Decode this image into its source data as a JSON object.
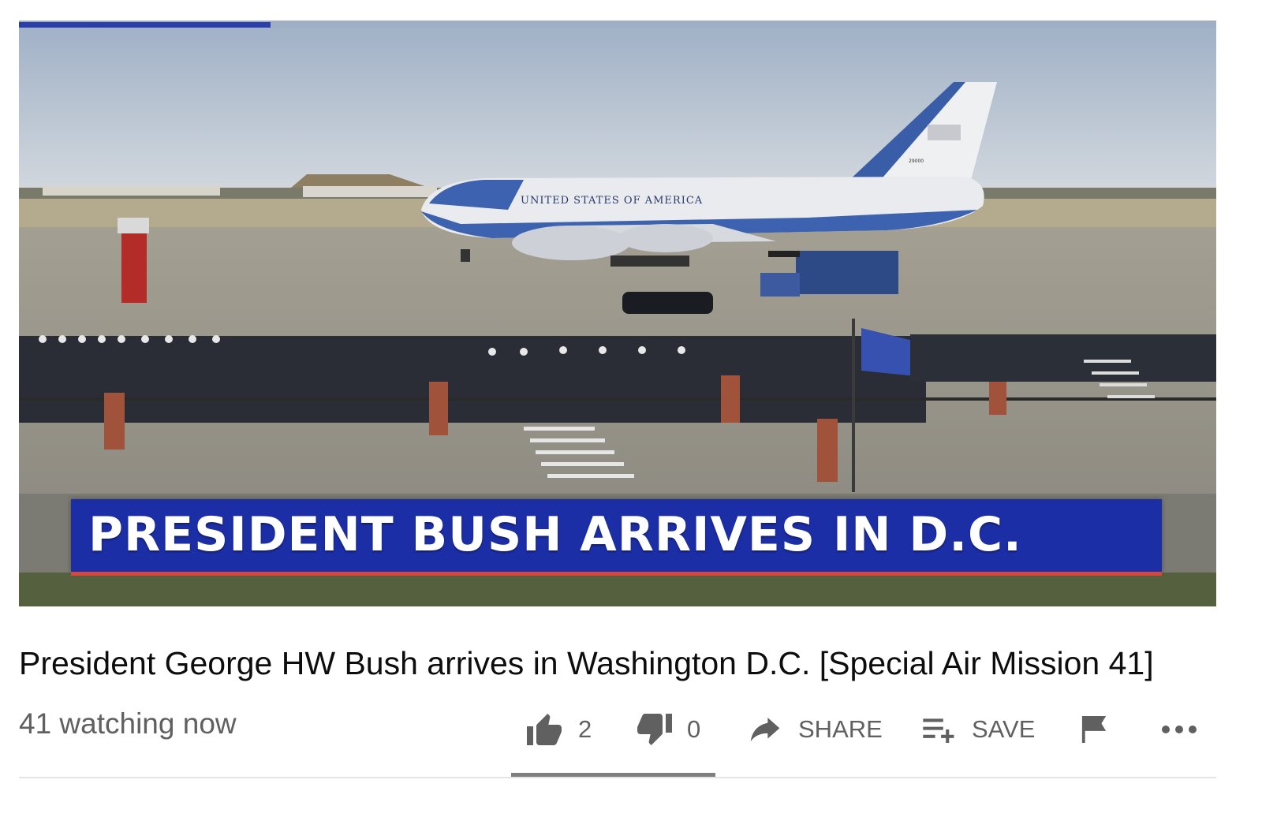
{
  "video": {
    "banner_text": "PRESIDENT BUSH ARRIVES IN D.C.",
    "aircraft_text": "UNITED STATES OF AMERICA",
    "tail_number": "29000",
    "progress_fraction": 0.21,
    "colors": {
      "banner": "#1c2ea6",
      "banner_strip": "#d8473a",
      "progress": "#2a3fa8"
    }
  },
  "title": "President George HW Bush arrives in Washington D.C. [Special Air Mission 41]",
  "watching": "41 watching now",
  "actions": {
    "like_count": "2",
    "dislike_count": "0",
    "share_label": "SHARE",
    "save_label": "SAVE"
  },
  "icons": {
    "like": "thumbs-up-icon",
    "dislike": "thumbs-down-icon",
    "share": "share-arrow-icon",
    "save": "playlist-add-icon",
    "report": "flag-icon",
    "more": "more-horizontal-icon"
  }
}
